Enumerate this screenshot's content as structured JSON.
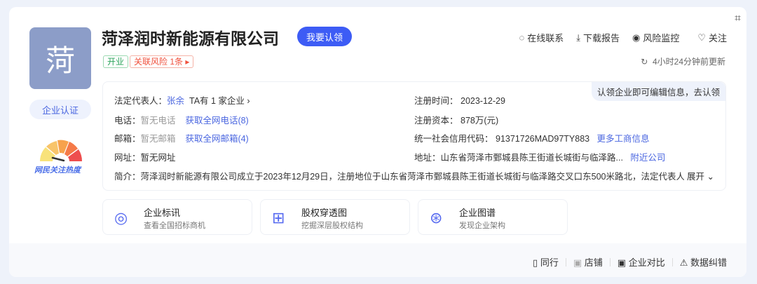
{
  "company": {
    "logo_char": "菏",
    "name": "菏泽润时新能源有限公司",
    "claim_button": "我要认领",
    "status_tag": "开业",
    "risk_tag": "关联风险 1条",
    "cert_button": "企业认证",
    "heat_label": "网民关注热度"
  },
  "actions": [
    {
      "icon": "chat-icon",
      "label": "在线联系"
    },
    {
      "icon": "download-icon",
      "label": "下载报告"
    },
    {
      "icon": "eye-icon",
      "label": "风险监控"
    },
    {
      "icon": "heart-icon",
      "label": "关注"
    }
  ],
  "update_text": "4小时24分钟前更新",
  "info": {
    "hint": "认领企业即可编辑信息，去认领",
    "legal_label": "法定代表人：",
    "legal_name": "张余",
    "legal_more": "TA有 1 家企业",
    "phone_label": "电话：",
    "phone_value": "暂无电话",
    "phone_link": "获取全网电话(8)",
    "email_label": "邮箱：",
    "email_value": "暂无邮箱",
    "email_link": "获取全网邮箱(4)",
    "web_label": "网址：",
    "web_value": "暂无网址",
    "reg_date_label": "注册时间：",
    "reg_date": "2023-12-29",
    "capital_label": "注册资本：",
    "capital": "878万(元)",
    "credit_label": "统一社会信用代码：",
    "credit_code": "91371726MAD97TY883",
    "credit_link": "更多工商信息",
    "address_label": "地址：",
    "address": "山东省菏泽市鄄城县陈王街道长城街与临泽路...",
    "address_link": "附近公司",
    "intro_label": "简介：",
    "intro": "菏泽润时新能源有限公司成立于2023年12月29日，注册地位于山东省菏泽市鄄城县陈王街道长城街与临泽路交叉口东500米路北，法定代表人...",
    "expand": "展开"
  },
  "tools": [
    {
      "title": "企业标讯",
      "sub": "查看全国招标商机"
    },
    {
      "title": "股权穿透图",
      "sub": "挖掘深层股权结构"
    },
    {
      "title": "企业图谱",
      "sub": "发现企业架构"
    }
  ],
  "footer": [
    "同行",
    "店铺",
    "企业对比",
    "数据纠错"
  ]
}
